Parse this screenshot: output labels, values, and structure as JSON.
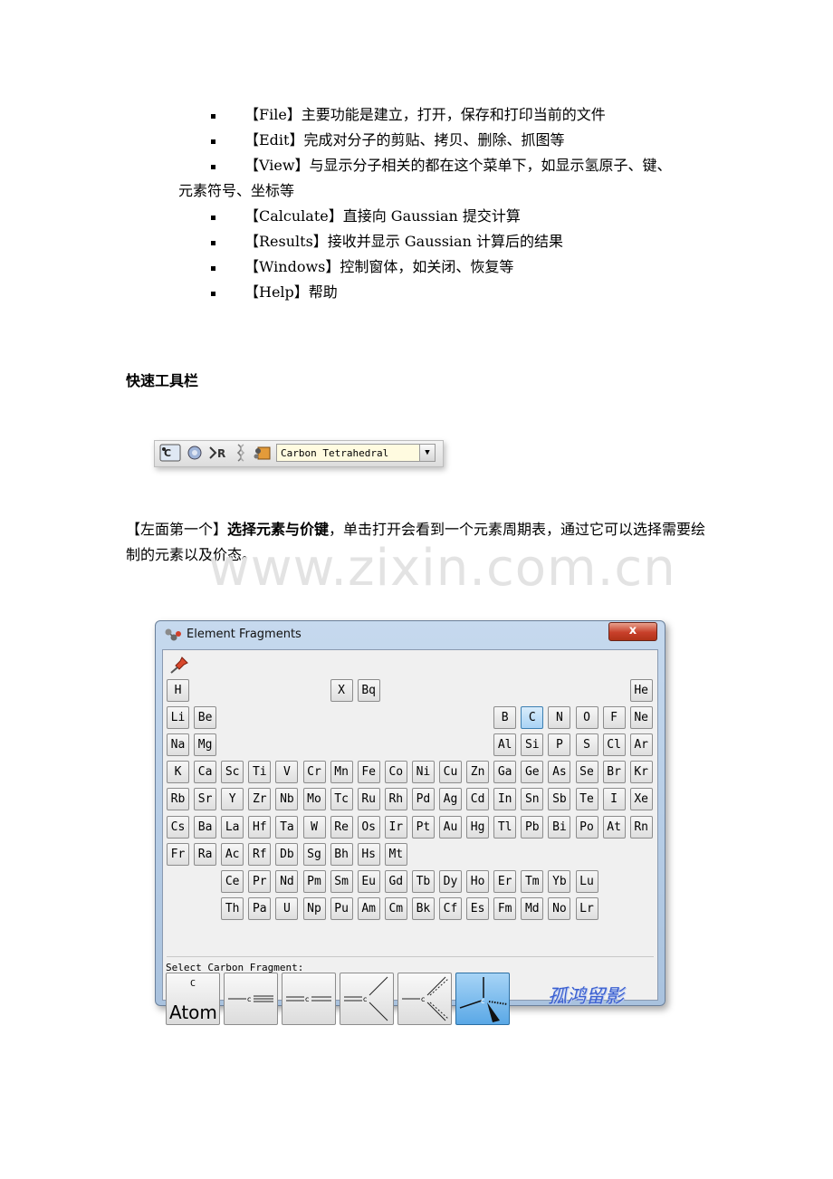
{
  "menu_items": [
    {
      "text": "【File】主要功能是建立，打开，保存和打印当前的文件"
    },
    {
      "text": "【Edit】完成对分子的剪贴、拷贝、删除、抓图等"
    },
    {
      "text": "【View】与显示分子相关的都在这个菜单下，如显示氢原子、键、"
    },
    {
      "text": "【Calculate】直接向 Gaussian 提交计算"
    },
    {
      "text": "【Results】接收并显示 Gaussian 计算后的结果"
    },
    {
      "text": "【Windows】控制窗体，如关闭、恢复等"
    },
    {
      "text": "【Help】帮助"
    }
  ],
  "view_continuation": "元素符号、坐标等",
  "section_title": "快速工具栏",
  "toolbar": {
    "combo_value": "Carbon Tetrahedral"
  },
  "description": {
    "bracket_part": "【左面第一个】",
    "bold_part": "选择元素与价键",
    "rest": "，单击打开会看到一个元素周期表，通过它可以选择需要绘制的元素以及价态。"
  },
  "watermark": "www.zixin.com.cn",
  "dialog": {
    "title": "Element Fragments",
    "close_label": "x",
    "fragment_label": "Select Carbon Fragment:",
    "atom_label": "Atom",
    "atom_symbol": "C",
    "signature": "孤鸿留影",
    "selected_element": "C",
    "rows": [
      [
        "H",
        "X",
        "Bq",
        "He"
      ],
      [
        "Li",
        "Be",
        "B",
        "C",
        "N",
        "O",
        "F",
        "Ne"
      ],
      [
        "Na",
        "Mg",
        "Al",
        "Si",
        "P",
        "S",
        "Cl",
        "Ar"
      ],
      [
        "K",
        "Ca",
        "Sc",
        "Ti",
        "V",
        "Cr",
        "Mn",
        "Fe",
        "Co",
        "Ni",
        "Cu",
        "Zn",
        "Ga",
        "Ge",
        "As",
        "Se",
        "Br",
        "Kr"
      ],
      [
        "Rb",
        "Sr",
        "Y",
        "Zr",
        "Nb",
        "Mo",
        "Tc",
        "Ru",
        "Rh",
        "Pd",
        "Ag",
        "Cd",
        "In",
        "Sn",
        "Sb",
        "Te",
        "I",
        "Xe"
      ],
      [
        "Cs",
        "Ba",
        "La",
        "Hf",
        "Ta",
        "W",
        "Re",
        "Os",
        "Ir",
        "Pt",
        "Au",
        "Hg",
        "Tl",
        "Pb",
        "Bi",
        "Po",
        "At",
        "Rn"
      ],
      [
        "Fr",
        "Ra",
        "Ac",
        "Rf",
        "Db",
        "Sg",
        "Bh",
        "Hs",
        "Mt"
      ],
      [
        "Ce",
        "Pr",
        "Nd",
        "Pm",
        "Sm",
        "Eu",
        "Gd",
        "Tb",
        "Dy",
        "Ho",
        "Er",
        "Tm",
        "Yb",
        "Lu"
      ],
      [
        "Th",
        "Pa",
        "U",
        "Np",
        "Pu",
        "Am",
        "Cm",
        "Bk",
        "Cf",
        "Es",
        "Fm",
        "Md",
        "No",
        "Lr"
      ]
    ]
  }
}
